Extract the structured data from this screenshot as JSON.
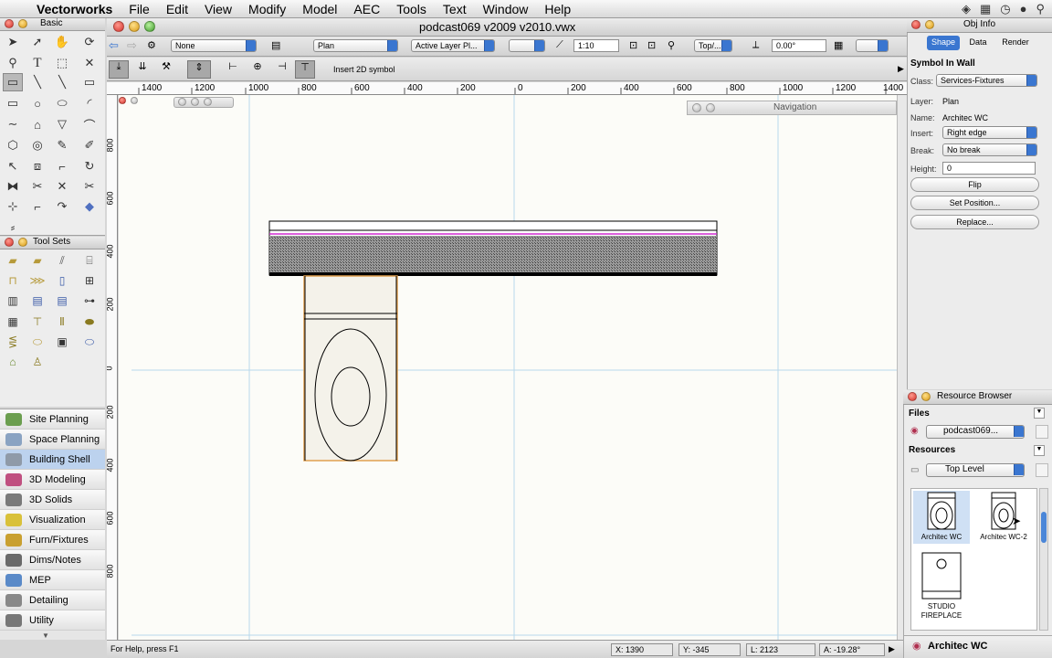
{
  "menubar": {
    "app": "Vectorworks",
    "items": [
      "File",
      "Edit",
      "View",
      "Modify",
      "Model",
      "AEC",
      "Tools",
      "Text",
      "Window",
      "Help"
    ]
  },
  "palette_basic": {
    "title": "Basic"
  },
  "palette_toolsets": {
    "title": "Tool Sets"
  },
  "workspaces": [
    {
      "label": "Site Planning",
      "color": "#6b9e4f"
    },
    {
      "label": "Space Planning",
      "color": "#8aa3c2"
    },
    {
      "label": "Building Shell",
      "color": "#8f9aa8"
    },
    {
      "label": "3D Modeling",
      "color": "#c05080"
    },
    {
      "label": "3D Solids",
      "color": "#7a7a7a"
    },
    {
      "label": "Visualization",
      "color": "#d9c13a"
    },
    {
      "label": "Furn/Fixtures",
      "color": "#c9a030"
    },
    {
      "label": "Dims/Notes",
      "color": "#6a6a6a"
    },
    {
      "label": "MEP",
      "color": "#5a8ac8"
    },
    {
      "label": "Detailing",
      "color": "#888888"
    },
    {
      "label": "Utility",
      "color": "#777777"
    }
  ],
  "document": {
    "title": "podcast069 v2009 v2010.vwx"
  },
  "viewbar": {
    "class_value": "None",
    "layer_value": "Plan",
    "active_layer": "Active Layer Pl...",
    "scale": "1:10",
    "view": "Top/...",
    "rotation": "0.00°"
  },
  "modebar": {
    "hint": "Insert 2D symbol"
  },
  "ruler": {
    "top_labels": [
      "1400",
      "1200",
      "1000",
      "800",
      "600",
      "400",
      "200",
      "0",
      "200",
      "400",
      "600",
      "800",
      "1000",
      "1200",
      "1400"
    ],
    "left_labels": [
      "800",
      "600",
      "400",
      "200",
      "0",
      "200",
      "400",
      "600",
      "800"
    ]
  },
  "navigation": {
    "title": "Navigation"
  },
  "status": {
    "help": "For Help, press F1",
    "x": "X:  1390",
    "y": "Y:  -345",
    "l": "L:  2123",
    "a": "A:  -19.28°"
  },
  "obj_info": {
    "title": "Obj Info",
    "tabs": [
      "Shape",
      "Data",
      "Render"
    ],
    "object_type": "Symbol In Wall",
    "class_label": "Class:",
    "class_value": "Services-Fixtures",
    "layer_label": "Layer:",
    "layer_value": "Plan",
    "name_label": "Name:",
    "name_value": "Architec WC",
    "insert_label": "Insert:",
    "insert_value": "Right edge",
    "break_label": "Break:",
    "break_value": "No break",
    "height_label": "Height:",
    "height_value": "0",
    "buttons": [
      "Flip",
      "Set Position...",
      "Replace..."
    ]
  },
  "resource_browser": {
    "title": "Resource Browser",
    "files_label": "Files",
    "file_value": "podcast069...",
    "resources_label": "Resources",
    "folder_value": "Top Level",
    "items": [
      {
        "label": "Architec WC"
      },
      {
        "label": "Architec WC-2"
      },
      {
        "label": "STUDIO FIREPLACE"
      }
    ],
    "selected": "Architec WC"
  },
  "colors": {
    "accent": "#3a76d0",
    "wall_pink": "#d02cd0",
    "symbol_outline": "#e0a050",
    "grid": "#b8d8ec"
  }
}
